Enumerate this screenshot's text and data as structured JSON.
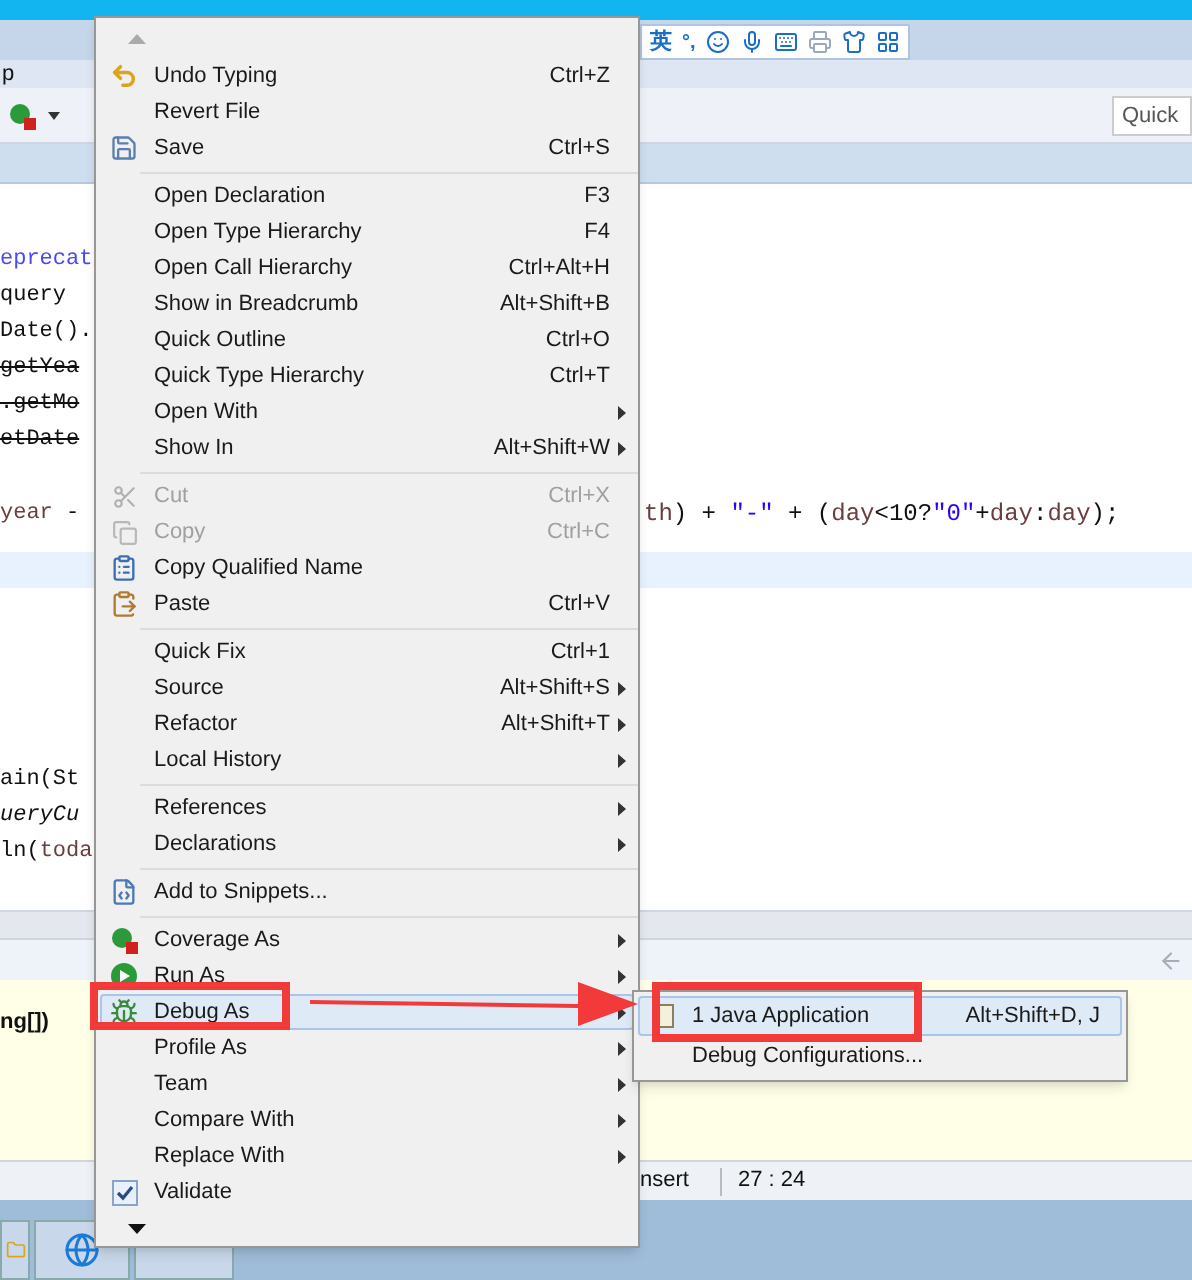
{
  "menubar": {
    "label": "p"
  },
  "ime_bar": {
    "language": "英",
    "punctuation": "°,"
  },
  "quick_access": {
    "value": "Quick"
  },
  "editor": {
    "lines_top": [
      {
        "left": [
          {
            "kind": "annotation",
            "text": "eprecat"
          }
        ]
      },
      {
        "left": [
          {
            "kind": "plain",
            "text": "query"
          }
        ]
      },
      {
        "left": [
          {
            "kind": "plain",
            "text": "Date()."
          }
        ]
      },
      {
        "left": [
          {
            "kind": "deprecated",
            "text": "getYea"
          }
        ]
      },
      {
        "left": [
          {
            "kind": "deprecated",
            "text": ".getMo"
          }
        ]
      },
      {
        "left": [
          {
            "kind": "deprecated",
            "text": "etDate"
          }
        ]
      }
    ],
    "year_line": {
      "left": [
        {
          "kind": "var",
          "text": "year"
        },
        {
          "kind": "plain",
          "text": " -"
        }
      ],
      "right": [
        {
          "kind": "var",
          "text": "th"
        },
        {
          "kind": "plain",
          "text": ") + "
        },
        {
          "kind": "string",
          "text": "\"-\""
        },
        {
          "kind": "plain",
          "text": " + ("
        },
        {
          "kind": "var",
          "text": "day"
        },
        {
          "kind": "plain",
          "text": "<10?"
        },
        {
          "kind": "string",
          "text": "\"0\""
        },
        {
          "kind": "plain",
          "text": "+"
        },
        {
          "kind": "var",
          "text": "day"
        },
        {
          "kind": "plain",
          "text": ":"
        },
        {
          "kind": "var",
          "text": "day"
        },
        {
          "kind": "plain",
          "text": ");"
        }
      ]
    },
    "lines_bottom": [
      {
        "left": [
          {
            "kind": "plain",
            "text": "ain(St"
          }
        ]
      },
      {
        "left": [
          {
            "kind": "italic",
            "text": "ueryCu"
          }
        ]
      },
      {
        "left": [
          {
            "kind": "plain",
            "text": "ln("
          },
          {
            "kind": "var",
            "text": "toda"
          }
        ]
      }
    ]
  },
  "console": {
    "text": "ng[])"
  },
  "status_bar": {
    "mode": "nsert",
    "position": "27 : 24"
  },
  "context_menu": {
    "groups": [
      [
        {
          "kind": "command",
          "label": "Undo Typing",
          "shortcut": "Ctrl+Z",
          "submenu": false,
          "disabled": false,
          "selected": false
        },
        {
          "kind": "command",
          "label": "Revert File",
          "submenu": false,
          "disabled": false,
          "selected": false
        },
        {
          "kind": "command",
          "label": "Save",
          "shortcut": "Ctrl+S",
          "submenu": false,
          "disabled": false,
          "selected": false
        }
      ],
      [
        {
          "kind": "command",
          "label": "Open Declaration",
          "shortcut": "F3",
          "submenu": false,
          "disabled": false,
          "selected": false
        },
        {
          "kind": "command",
          "label": "Open Type Hierarchy",
          "shortcut": "F4",
          "submenu": false,
          "disabled": false,
          "selected": false
        },
        {
          "kind": "command",
          "label": "Open Call Hierarchy",
          "shortcut": "Ctrl+Alt+H",
          "submenu": false,
          "disabled": false,
          "selected": false
        },
        {
          "kind": "command",
          "label": "Show in Breadcrumb",
          "shortcut": "Alt+Shift+B",
          "submenu": false,
          "disabled": false,
          "selected": false
        },
        {
          "kind": "command",
          "label": "Quick Outline",
          "shortcut": "Ctrl+O",
          "submenu": false,
          "disabled": false,
          "selected": false
        },
        {
          "kind": "command",
          "label": "Quick Type Hierarchy",
          "shortcut": "Ctrl+T",
          "submenu": false,
          "disabled": false,
          "selected": false
        },
        {
          "kind": "command",
          "label": "Open With",
          "submenu": true,
          "disabled": false,
          "selected": false
        },
        {
          "kind": "command",
          "label": "Show In",
          "shortcut": "Alt+Shift+W",
          "submenu": true,
          "disabled": false,
          "selected": false
        }
      ],
      [
        {
          "kind": "command",
          "label": "Cut",
          "shortcut": "Ctrl+X",
          "submenu": false,
          "disabled": true,
          "selected": false
        },
        {
          "kind": "command",
          "label": "Copy",
          "shortcut": "Ctrl+C",
          "submenu": false,
          "disabled": true,
          "selected": false
        },
        {
          "kind": "command",
          "label": "Copy Qualified Name",
          "submenu": false,
          "disabled": false,
          "selected": false
        },
        {
          "kind": "command",
          "label": "Paste",
          "shortcut": "Ctrl+V",
          "submenu": false,
          "disabled": false,
          "selected": false
        }
      ],
      [
        {
          "kind": "command",
          "label": "Quick Fix",
          "shortcut": "Ctrl+1",
          "submenu": false,
          "disabled": false,
          "selected": false
        },
        {
          "kind": "command",
          "label": "Source",
          "shortcut": "Alt+Shift+S",
          "submenu": true,
          "disabled": false,
          "selected": false
        },
        {
          "kind": "command",
          "label": "Refactor",
          "shortcut": "Alt+Shift+T",
          "submenu": true,
          "disabled": false,
          "selected": false
        },
        {
          "kind": "command",
          "label": "Local History",
          "submenu": true,
          "disabled": false,
          "selected": false
        }
      ],
      [
        {
          "kind": "command",
          "label": "References",
          "submenu": true,
          "disabled": false,
          "selected": false
        },
        {
          "kind": "command",
          "label": "Declarations",
          "submenu": true,
          "disabled": false,
          "selected": false
        }
      ],
      [
        {
          "kind": "command",
          "label": "Add to Snippets...",
          "submenu": false,
          "disabled": false,
          "selected": false
        }
      ],
      [
        {
          "kind": "command",
          "label": "Coverage As",
          "submenu": true,
          "disabled": false,
          "selected": false
        },
        {
          "kind": "command",
          "label": "Run As",
          "submenu": true,
          "disabled": false,
          "selected": false
        },
        {
          "kind": "command",
          "label": "Debug As",
          "submenu": true,
          "disabled": false,
          "selected": true
        },
        {
          "kind": "command",
          "label": "Profile As",
          "submenu": true,
          "disabled": false,
          "selected": false
        },
        {
          "kind": "command",
          "label": "Team",
          "submenu": true,
          "disabled": false,
          "selected": false
        },
        {
          "kind": "command",
          "label": "Compare With",
          "submenu": true,
          "disabled": false,
          "selected": false
        },
        {
          "kind": "command",
          "label": "Replace With",
          "submenu": true,
          "disabled": false,
          "selected": false
        },
        {
          "kind": "check",
          "label": "Validate",
          "checked": true,
          "submenu": false,
          "disabled": false,
          "selected": false
        }
      ]
    ]
  },
  "submenu": {
    "items": [
      {
        "label": "1 Java Application",
        "shortcut": "Alt+Shift+D, J",
        "selected": true
      },
      {
        "label": "Debug Configurations...",
        "selected": false
      }
    ]
  }
}
